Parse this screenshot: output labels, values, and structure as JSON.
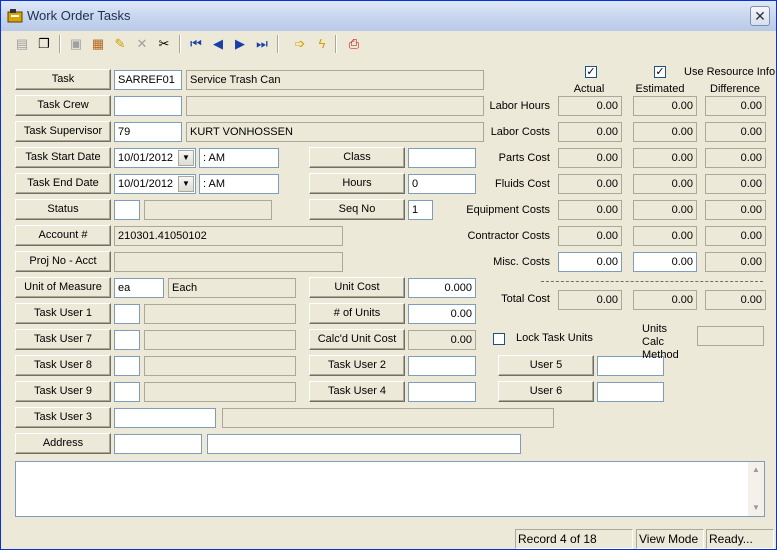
{
  "window": {
    "title": "Work Order Tasks"
  },
  "toolbar": {
    "icons": [
      "new-icon",
      "copy-icon",
      "save-icon",
      "attach-icon",
      "edit-icon",
      "delete-icon",
      "cut-icon",
      "first-record-icon",
      "prev-record-icon",
      "next-record-icon",
      "last-record-icon",
      "go-icon",
      "lightning-icon",
      "print-icon"
    ]
  },
  "form": {
    "task_label": "Task",
    "task_code": "SARREF01",
    "task_desc": "Service Trash Can",
    "task_crew_label": "Task Crew",
    "task_crew_code": "",
    "task_crew_desc": "",
    "task_supervisor_label": "Task Supervisor",
    "task_supervisor_code": "79",
    "task_supervisor_name": "KURT VONHOSSEN",
    "task_start_label": "Task Start Date",
    "task_start_date": "10/01/2012",
    "task_start_time": " :  AM",
    "task_end_label": "Task End Date",
    "task_end_date": "10/01/2012",
    "task_end_time": " :  AM",
    "status_label": "Status",
    "status_code": "",
    "status_desc": "",
    "account_label": "Account #",
    "account_value": "210301.41050102",
    "proj_label": "Proj No - Acct",
    "proj_value": "",
    "uom_label": "Unit of Measure",
    "uom_code": "ea",
    "uom_desc": "Each",
    "task_user1_label": "Task User 1",
    "task_user7_label": "Task User 7",
    "task_user8_label": "Task User 8",
    "task_user9_label": "Task User 9",
    "task_user3_label": "Task User 3",
    "address_label": "Address",
    "class_label": "Class",
    "class_value": "",
    "hours_label": "Hours",
    "hours_value": "0",
    "seq_label": "Seq No",
    "seq_value": "1",
    "unit_cost_label": "Unit Cost",
    "unit_cost_value": "0.000",
    "num_units_label": "# of Units",
    "num_units_value": "0.00",
    "calc_unit_cost_label": "Calc'd Unit Cost",
    "calc_unit_cost_value": "0.00",
    "task_user2_label": "Task User 2",
    "task_user4_label": "Task User 4",
    "user5_label": "User 5",
    "user6_label": "User 6",
    "lock_task_units_label": "Lock Task Units",
    "units_calc_method_label": "Units Calc Method"
  },
  "costs": {
    "use_resource_info_label": "Use Resource Info",
    "headers": {
      "actual": "Actual",
      "estimated": "Estimated",
      "difference": "Difference"
    },
    "rows": [
      {
        "label": "Labor Hours",
        "actual": "0.00",
        "estimated": "0.00",
        "difference": "0.00"
      },
      {
        "label": "Labor Costs",
        "actual": "0.00",
        "estimated": "0.00",
        "difference": "0.00"
      },
      {
        "label": "Parts Cost",
        "actual": "0.00",
        "estimated": "0.00",
        "difference": "0.00"
      },
      {
        "label": "Fluids Cost",
        "actual": "0.00",
        "estimated": "0.00",
        "difference": "0.00"
      },
      {
        "label": "Equipment Costs",
        "actual": "0.00",
        "estimated": "0.00",
        "difference": "0.00"
      },
      {
        "label": "Contractor Costs",
        "actual": "0.00",
        "estimated": "0.00",
        "difference": "0.00"
      },
      {
        "label": "Misc. Costs",
        "actual": "0.00",
        "estimated": "0.00",
        "difference": "0.00"
      }
    ],
    "total": {
      "label": "Total Cost",
      "actual": "0.00",
      "estimated": "0.00",
      "difference": "0.00"
    }
  },
  "statusbar": {
    "record": "Record 4 of 18",
    "mode": "View Mode",
    "state": "Ready..."
  }
}
